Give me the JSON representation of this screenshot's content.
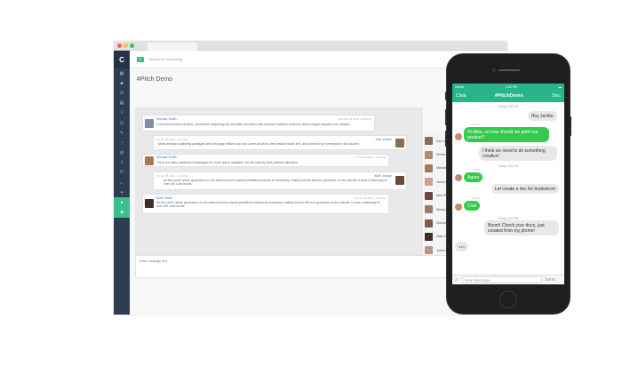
{
  "app": {
    "logo": "C",
    "search_placeholder": "Search for something...",
    "page_title": "#Pitch Demo",
    "entry_placeholder": "Enter message text"
  },
  "messages": [
    {
      "name": "Michael Smith",
      "time": "Wed Jan 28 2015 - 09:00:00",
      "text": "Lorem ipsum dolor sit amet, consectetur adipiscing elit, sed diam nonummy nibh euismod tincidunt ut laoreet dolore magna aliquam erat volutpat."
    },
    {
      "name": "Karl Jordan",
      "time": "Fri Jan 25 2015 - 11:15:00",
      "text": "Many desktop publishing packages and web page editors now use Lorem Ipsum as their default model text, and a search for 'lorem ipsum' will uncover."
    },
    {
      "name": "Michael Smith",
      "time": "Fri Jan 25 2015 - 11:15:00",
      "text": "There are many variations of passages of Lorem Ipsum available, but the majority have suffered alteration."
    },
    {
      "name": "Alice Jordan",
      "time": "Fri Jan 25 2015 - 11:15:00",
      "text": "All the Lorem Ipsum generators on the Internet tend to repeat predefined chunks as necessary, making this the first true generator on the Internet. It uses a dictionary of over 200 Latin words."
    },
    {
      "name": "Mark Smith",
      "time": "Fri Jan 25 2015 - 11:15:00",
      "text": "All the Lorem Ipsum generators on the Internet tend to repeat predefined chunks as necessary, making this the first true generator on the Internet. It uses a dictionary of over 200 Latin words."
    }
  ],
  "users": [
    "Karl Jordan",
    "Monica Smith",
    "Michael Smith",
    "Janet Smith",
    "Alice Smith",
    "Monica Smith",
    "Monica Cala",
    "Mark Smith",
    "Janet Smith"
  ],
  "phone": {
    "carrier": "Carrier",
    "clock": "4:33 PM",
    "nav_left": "Chat",
    "nav_title": "#PitchDemo",
    "nav_right": "Doc",
    "times": [
      "Today 4:08 PM",
      "Today 4:51 PM",
      "Today 4:02 PM"
    ],
    "sender": "jenifer",
    "bubbles": [
      "Hey Jenifer",
      "Hi Mike, so how should we pitch our product?",
      "I think we need to do something creative!",
      "Agree",
      "Let create a doc for brainstrom",
      "Cool",
      "Boom! Check your docs, just created from my phone!"
    ],
    "typing": "●●●",
    "composer_placeholder": "New Message",
    "send": "Send"
  },
  "colors": {
    "accent": "#3bbf8f",
    "sidebar": "#2d3e50",
    "bubble_in": "#36c94f",
    "link": "#3a79c4"
  }
}
